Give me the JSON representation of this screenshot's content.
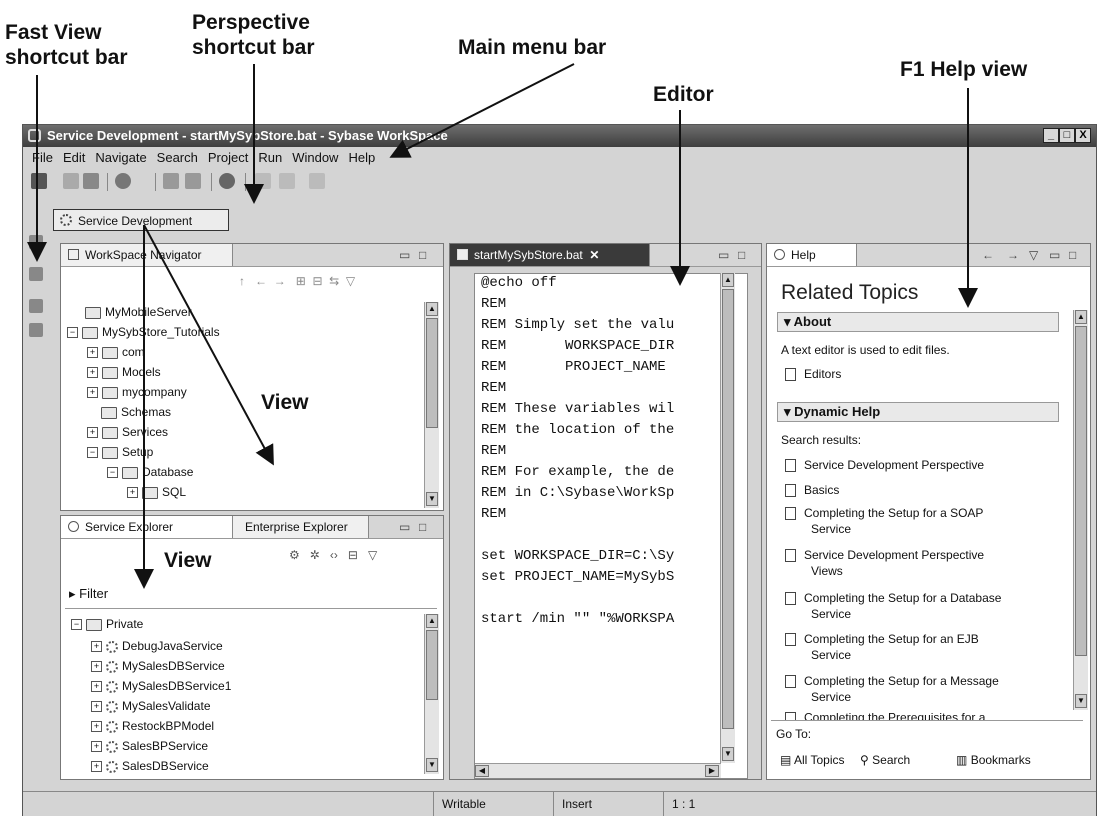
{
  "callouts": {
    "fast_view": "Fast View\nshortcut bar",
    "perspective": "Perspective\nshortcut bar",
    "main_menu": "Main menu bar",
    "editor": "Editor",
    "help": "F1 Help view",
    "view_top": "View",
    "view_bottom": "View"
  },
  "window": {
    "title": "Service Development - startMySybStore.bat - Sybase WorkSpace",
    "controls": {
      "min": "_",
      "max": "□",
      "close": "X"
    }
  },
  "menu": [
    "File",
    "Edit",
    "Navigate",
    "Search",
    "Project",
    "Run",
    "Window",
    "Help"
  ],
  "perspective": {
    "label": "Service Development"
  },
  "navigator": {
    "tab": "WorkSpace Navigator",
    "items": [
      "MyMobileServer",
      "MySybStore_Tutorials",
      "com",
      "Models",
      "mycompany",
      "Schemas",
      "Services",
      "Setup",
      "Database",
      "SQL"
    ]
  },
  "explorer": {
    "tab1": "Service Explorer",
    "tab2": "Enterprise Explorer",
    "filter": "Filter",
    "root": "Private",
    "items": [
      "DebugJavaService",
      "MySalesDBService",
      "MySalesDBService1",
      "MySalesValidate",
      "RestockBPModel",
      "SalesBPService",
      "SalesDBService"
    ]
  },
  "editor": {
    "tab": "startMySybStore.bat",
    "lines": [
      "@echo off",
      "REM",
      "REM Simply set the valu",
      "REM       WORKSPACE_DIR",
      "REM       PROJECT_NAME",
      "REM",
      "REM These variables wil",
      "REM the location of the",
      "REM",
      "REM For example, the de",
      "REM in C:\\Sybase\\WorkSp",
      "REM",
      "",
      "set WORKSPACE_DIR=C:\\Sy",
      "set PROJECT_NAME=MySybS",
      "",
      "start /min \"\" \"%WORKSPA"
    ]
  },
  "help": {
    "tab": "Help",
    "heading": "Related Topics",
    "about": {
      "title": "About",
      "text": "A text editor is used to edit files.",
      "link": "Editors"
    },
    "dynamic": {
      "title": "Dynamic Help",
      "search_label": "Search results:",
      "results": [
        [
          "Service Development Perspective"
        ],
        [
          "Basics"
        ],
        [
          "Completing the Setup for a SOAP",
          "Service"
        ],
        [
          "Service Development Perspective",
          "Views"
        ],
        [
          "Completing the Setup for a Database",
          "Service"
        ],
        [
          "Completing the Setup for an EJB",
          "Service"
        ],
        [
          "Completing the Setup for a Message",
          "Service"
        ],
        [
          "Completing the Prerequisites for a"
        ]
      ]
    },
    "goto": {
      "label": "Go To:",
      "all_topics": "All Topics",
      "search": "Search",
      "bookmarks": "Bookmarks"
    }
  },
  "status": {
    "writable": "Writable",
    "insert": "Insert",
    "position": "1 : 1"
  }
}
